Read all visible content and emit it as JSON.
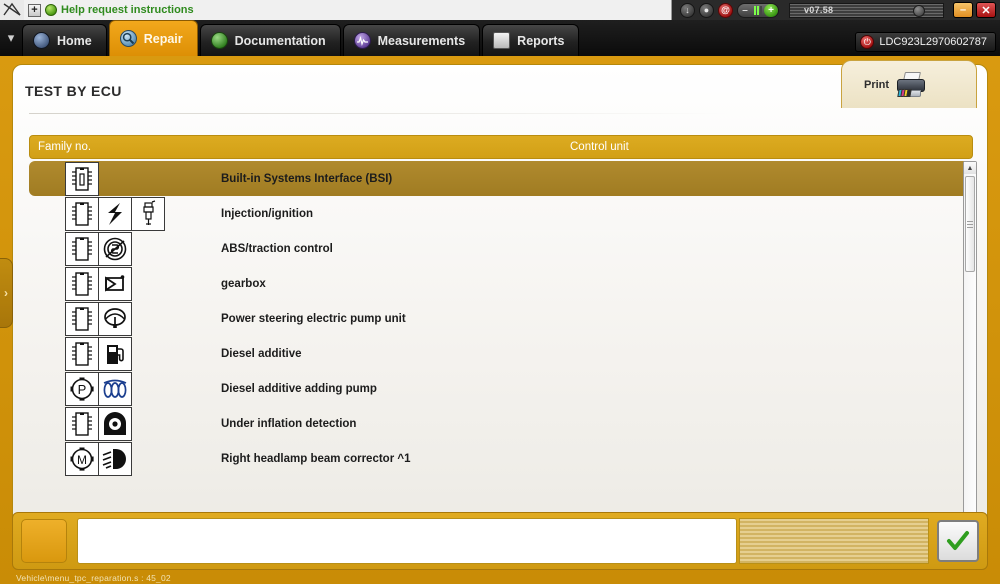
{
  "system_bar": {
    "help_text": "Help request instructions",
    "plus_label": "+",
    "version": "v07.58",
    "icons": [
      {
        "name": "download-icon",
        "glyph": "↓"
      },
      {
        "name": "droplet-icon",
        "glyph": "●"
      },
      {
        "name": "email-at-icon",
        "glyph": "@"
      }
    ],
    "volume": {
      "minus": "–",
      "plus": "+"
    },
    "window": {
      "minimize": "–",
      "close": "✕"
    }
  },
  "tabs": [
    {
      "label": "Home",
      "icon": "home-globe-icon",
      "glyph": "●",
      "active": false
    },
    {
      "label": "Repair",
      "icon": "magnifier-icon",
      "glyph": "⌕",
      "active": true
    },
    {
      "label": "Documentation",
      "icon": "book-icon",
      "glyph": "◧",
      "active": false
    },
    {
      "label": "Measurements",
      "icon": "waveform-icon",
      "glyph": "∿",
      "active": false
    },
    {
      "label": "Reports",
      "icon": "report-page-icon",
      "glyph": "",
      "active": false
    }
  ],
  "vin": {
    "value": "LDC923L2970602787",
    "icon_glyph": "⏻"
  },
  "page": {
    "title": "TEST BY ECU",
    "print_label": "Print",
    "side_tab_glyph": "›"
  },
  "table": {
    "headers": {
      "family_no": "Family no.",
      "control_unit": "Control unit"
    },
    "rows": [
      {
        "label": "Built-in Systems Interface (BSI)",
        "selected": true,
        "icons": [
          "chip"
        ]
      },
      {
        "label": "Injection/ignition",
        "selected": false,
        "icons": [
          "chip",
          "spark",
          "sparkplug"
        ]
      },
      {
        "label": "ABS/traction control",
        "selected": false,
        "icons": [
          "chip",
          "abs"
        ]
      },
      {
        "label": "gearbox",
        "selected": false,
        "icons": [
          "chip",
          "gearbox"
        ]
      },
      {
        "label": "Power steering electric pump unit",
        "selected": false,
        "icons": [
          "chip",
          "steering"
        ]
      },
      {
        "label": "Diesel additive",
        "selected": false,
        "icons": [
          "chip",
          "fuelpump"
        ]
      },
      {
        "label": "Diesel additive adding pump",
        "selected": false,
        "icons": [
          "ppump",
          "coils"
        ]
      },
      {
        "label": "Under inflation detection",
        "selected": false,
        "icons": [
          "chip",
          "tyre"
        ]
      },
      {
        "label": "Right headlamp beam corrector ^1",
        "selected": false,
        "icons": [
          "motor",
          "headlamp"
        ]
      }
    ]
  },
  "bottom": {
    "input_value": "",
    "ok_glyph": "✔",
    "status_text": "Vehicle\\menu_tpc_reparation.s : 45_02"
  },
  "colors": {
    "gold": "#d99a10",
    "gold_dark": "#b98d10",
    "selected_row": "#a87f24",
    "accent_green": "#2f8b1e"
  }
}
